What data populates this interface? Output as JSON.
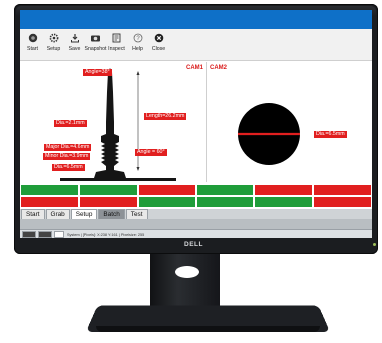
{
  "toolbar": {
    "items": [
      {
        "label": "Start",
        "icon": "record-icon"
      },
      {
        "label": "Setup",
        "icon": "gear-icon"
      },
      {
        "label": "Save",
        "icon": "download-icon"
      },
      {
        "label": "Snapshot",
        "icon": "camera-icon"
      },
      {
        "label": "Inspect",
        "icon": "inspect-icon"
      },
      {
        "label": "Help",
        "icon": "help-icon"
      },
      {
        "label": "Close",
        "icon": "close-icon"
      }
    ]
  },
  "camera1": {
    "label": "CAM1",
    "measurements": {
      "angle_top": "Angle=38°",
      "length": "Length=26.2mm",
      "dia_top": "Dia.=2.1mm",
      "major_dia": "Major Dia.=4.6mm",
      "minor_dia": "Minor Dia.=3.9mm",
      "angle_right": "Angle = 60°",
      "dia_bottom": "Dia.=6.5mm"
    }
  },
  "camera2": {
    "label": "CAM2",
    "measurements": {
      "dia": "Dia.=6.5mm"
    }
  },
  "result_colors": {
    "pass": "#1f9d3a",
    "fail": "#e11f1f",
    "accent": "#0e70c8"
  },
  "tabs": [
    {
      "label": "Start",
      "state": "normal"
    },
    {
      "label": "Grab",
      "state": "normal"
    },
    {
      "label": "Setup",
      "state": "active"
    },
    {
      "label": "Batch",
      "state": "dark"
    },
    {
      "label": "Test",
      "state": "normal"
    }
  ],
  "statusbar": {
    "text": "System | [Pixels]: X:238 Y:161 | Pixelsize: 255"
  },
  "monitor": {
    "brand": "DELL"
  }
}
